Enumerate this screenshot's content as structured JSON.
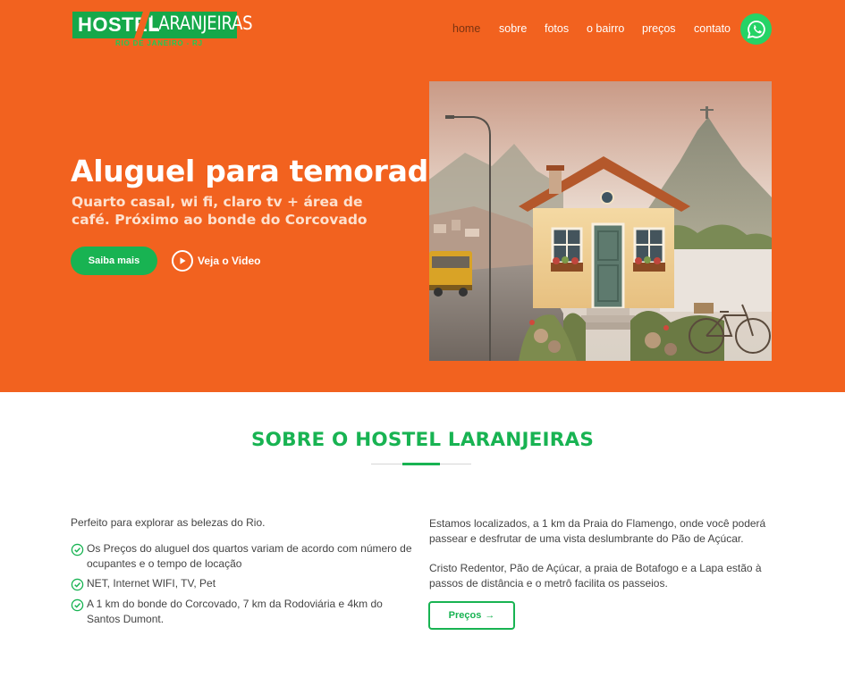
{
  "logo": {
    "word1": "HOSTEL",
    "word2": "LARANJEIRAS",
    "tagline": "RIO DE JANEIRO - RJ"
  },
  "nav": {
    "items": [
      {
        "label": "home",
        "active": true
      },
      {
        "label": "sobre"
      },
      {
        "label": "fotos"
      },
      {
        "label": "o bairro"
      },
      {
        "label": "preços"
      },
      {
        "label": "contato"
      }
    ],
    "whatsapp_icon": "whatsapp-icon"
  },
  "hero": {
    "title": "Aluguel para temorada",
    "subtitle": "Quarto casal, wi fi, claro tv + área de café. Próximo ao bonde do Corcovado",
    "primary_button": "Saiba mais",
    "video_link": "Veja o Video",
    "image_icon": "house-illustration"
  },
  "about": {
    "title": "SOBRE O HOSTEL LARANJEIRAS",
    "intro": "Perfeito para explorar as belezas do Rio.",
    "checks": [
      "Os Preços do aluguel dos quartos variam de acordo com número de ocupantes e o tempo de locação",
      "NET, Internet WIFI, TV, Pet",
      "A 1 km do bonde do Corcovado, 7 km da Rodoviária e 4km do Santos Dumont."
    ],
    "paragraph1": "Estamos localizados, a 1 km da Praia do Flamengo, onde você poderá passear e desfrutar de uma vista deslumbrante do Pão de Açúcar.",
    "paragraph2": "Cristo Redentor, Pão de Açúcar, a praia de Botafogo e a Lapa estão à passos de distância e o metrô facilita os passeios.",
    "button": "Preços",
    "button_arrow": "→"
  },
  "colors": {
    "brand_orange": "#f2621f",
    "brand_green": "#18b352",
    "whatsapp_green": "#25d366"
  }
}
